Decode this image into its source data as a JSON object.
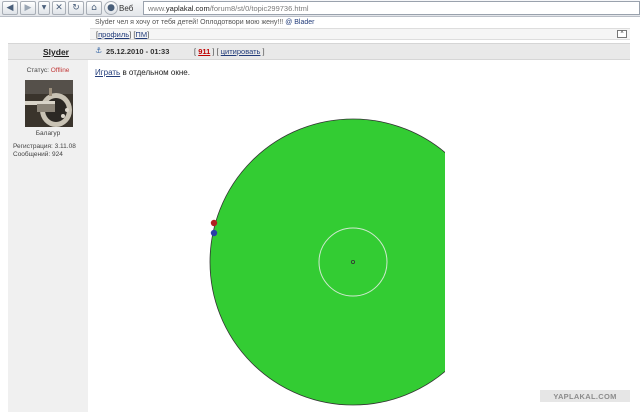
{
  "browser": {
    "web_label": "Веб",
    "url_prefix": "www.",
    "url_host": "yaplakal.com",
    "url_path": "/forum8/st/0/topic299736.html",
    "icons": [
      "back-arrow-icon",
      "forward-arrow-icon",
      "dropdown-icon",
      "stop-icon",
      "reload-icon",
      "home-icon",
      "web-icon"
    ]
  },
  "previous_post": {
    "text": "Slyder чел я хочу от тебя детей! Оплодотвори мою жену!!!",
    "signature": "@ Blader",
    "link_open": "[",
    "profile": "профиль",
    "sep": "] [",
    "pm": "ПМ",
    "link_close": "]",
    "top_button": "^"
  },
  "post": {
    "author": "Slyder",
    "date": "25.12.2010 - 01:33",
    "bracket_open": "[",
    "number": "911",
    "bracket_mid": "] [",
    "quote": "цитировать",
    "bracket_close": "]"
  },
  "author_info": {
    "status_label": "Статус:",
    "status_value": "Offline",
    "rank": "Балагур",
    "registration": "Регистрация: 3.11.08",
    "messages": "Сообщений: 924"
  },
  "content": {
    "play_link": "Играть",
    "rest": " в отдельном окне."
  },
  "game": {
    "disc_color": "#33cc33",
    "outline_color": "#333333",
    "inner_ring_color": "#cfe9cf",
    "red_dot_color": "#b02020",
    "blue_dot_color": "#2a3ea8"
  },
  "watermark": "YAPLAKAL.COM"
}
